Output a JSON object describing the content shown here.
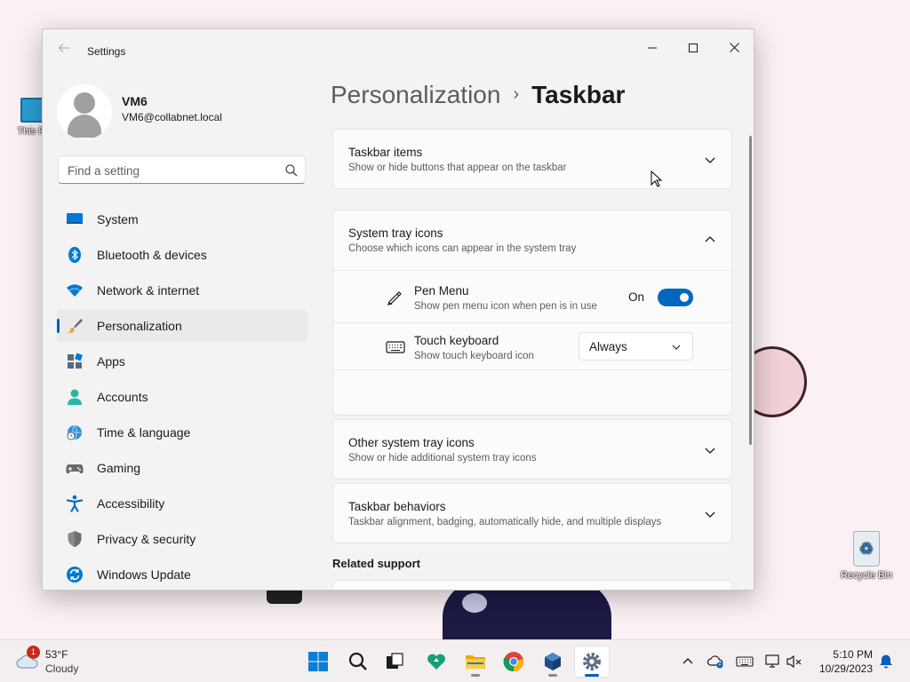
{
  "desktop": {
    "icons": [
      {
        "label": "This PC",
        "icon": "this-pc-icon"
      },
      {
        "label": "Recycle Bin",
        "icon": "recycle-bin-icon"
      }
    ]
  },
  "window": {
    "title": "Settings",
    "controls": {
      "minimize": "—",
      "maximize": "☐",
      "close": "✕"
    }
  },
  "profile": {
    "name": "VM6",
    "email": "VM6@collabnet.local"
  },
  "search": {
    "placeholder": "Find a setting"
  },
  "nav": {
    "items": [
      {
        "label": "System",
        "icon": "system-icon",
        "color": "#0078d4"
      },
      {
        "label": "Bluetooth & devices",
        "icon": "bluetooth-icon",
        "color": "#0078d4"
      },
      {
        "label": "Network & internet",
        "icon": "wifi-icon",
        "color": "#0078d4"
      },
      {
        "label": "Personalization",
        "icon": "paintbrush-icon",
        "color": "#e8a33d",
        "selected": true
      },
      {
        "label": "Apps",
        "icon": "apps-icon",
        "color": "#5a6a7a"
      },
      {
        "label": "Accounts",
        "icon": "accounts-icon",
        "color": "#2bb6a3"
      },
      {
        "label": "Time & language",
        "icon": "globe-clock-icon",
        "color": "#0078d4"
      },
      {
        "label": "Gaming",
        "icon": "gamepad-icon",
        "color": "#6b6b6b"
      },
      {
        "label": "Accessibility",
        "icon": "accessibility-icon",
        "color": "#0f6cbd"
      },
      {
        "label": "Privacy & security",
        "icon": "shield-icon",
        "color": "#7a7a7a"
      },
      {
        "label": "Windows Update",
        "icon": "update-icon",
        "color": "#0078d4"
      }
    ]
  },
  "breadcrumb": {
    "parent": "Personalization",
    "separator": "›",
    "current": "Taskbar"
  },
  "sections": {
    "taskbar_items": {
      "title": "Taskbar items",
      "subtitle": "Show or hide buttons that appear on the taskbar",
      "expanded": false
    },
    "system_tray_icons": {
      "title": "System tray icons",
      "subtitle": "Choose which icons can appear in the system tray",
      "expanded": true,
      "rows": {
        "pen_menu": {
          "title": "Pen Menu",
          "subtitle": "Show pen menu icon when pen is in use",
          "state_label": "On",
          "on": true
        },
        "touch_keyboard": {
          "title": "Touch keyboard",
          "subtitle": "Show touch keyboard icon",
          "selected": "Always"
        }
      }
    },
    "other_tray_icons": {
      "title": "Other system tray icons",
      "subtitle": "Show or hide additional system tray icons",
      "expanded": false
    },
    "taskbar_behaviors": {
      "title": "Taskbar behaviors",
      "subtitle": "Taskbar alignment, badging, automatically hide, and multiple displays",
      "expanded": false
    }
  },
  "related_support": {
    "heading": "Related support"
  },
  "taskbar": {
    "weather": {
      "temp": "53°F",
      "condition": "Cloudy",
      "badge": "1"
    },
    "apps": [
      {
        "name": "start",
        "icon": "windows-logo-icon"
      },
      {
        "name": "search",
        "icon": "search-icon"
      },
      {
        "name": "task-view",
        "icon": "task-view-icon"
      },
      {
        "name": "copilot",
        "icon": "heart-app-icon"
      },
      {
        "name": "file-explorer",
        "icon": "folder-icon"
      },
      {
        "name": "chrome",
        "icon": "chrome-icon"
      },
      {
        "name": "virtualbox",
        "icon": "cube-icon"
      },
      {
        "name": "settings",
        "icon": "gear-icon",
        "active": true
      }
    ],
    "tray": {
      "icons": [
        "chevron-up-icon",
        "onedrive-icon",
        "keyboard-icon",
        "display-icon",
        "volume-muted-icon"
      ]
    },
    "clock": {
      "time": "5:10 PM",
      "date": "10/29/2023"
    }
  },
  "colors": {
    "accent": "#005fb8",
    "toggle_on": "#0067c0",
    "window_bg": "#f3f3f3",
    "card_bg": "#fbfbfb"
  }
}
